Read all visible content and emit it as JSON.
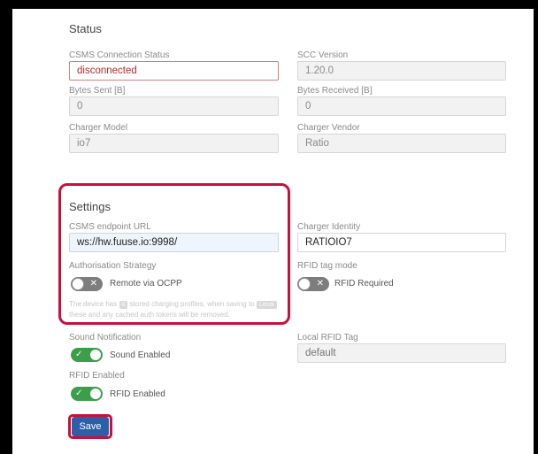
{
  "status": {
    "heading": "Status",
    "csms_connection_status": {
      "label": "CSMS Connection Status",
      "value": "disconnected"
    },
    "scc_version": {
      "label": "SCC Version",
      "value": "1.20.0"
    },
    "bytes_sent": {
      "label": "Bytes Sent [B]",
      "value": "0"
    },
    "bytes_received": {
      "label": "Bytes Received [B]",
      "value": "0"
    },
    "charger_model": {
      "label": "Charger Model",
      "value": "io7"
    },
    "charger_vendor": {
      "label": "Charger Vendor",
      "value": "Ratio"
    }
  },
  "settings": {
    "heading": "Settings",
    "csms_endpoint_url": {
      "label": "CSMS endpoint URL",
      "value": "ws://hw.fuuse.io:9998/"
    },
    "charger_identity": {
      "label": "Charger Identity",
      "value": "RATIOIO7"
    },
    "authorisation_strategy": {
      "label": "Authorisation Strategy",
      "toggle_label": "Remote via OCPP",
      "enabled": false
    },
    "rfid_tag_mode": {
      "label": "RFID tag mode",
      "toggle_label": "RFID Required",
      "enabled": false
    },
    "note": {
      "part1": "The device has",
      "count": "0",
      "part2": "stored charging profiles, when saving to",
      "badge": "Local",
      "part3": "these and any cached auth tokens will be removed."
    },
    "sound_notification": {
      "label": "Sound Notification",
      "toggle_label": "Sound Enabled",
      "enabled": true
    },
    "local_rfid_tag": {
      "label": "Local RFID Tag",
      "placeholder": "default"
    },
    "rfid_enabled": {
      "label": "RFID Enabled",
      "toggle_label": "RFID Enabled",
      "enabled": true
    },
    "save_label": "Save"
  },
  "glyphs": {
    "off": "✕",
    "on": "✓"
  },
  "colors": {
    "highlight": "#c8103e",
    "toggle_on": "#3c9e4a",
    "toggle_off": "#7d7d7d",
    "save_button": "#2c5fa8",
    "error_text": "#b02a2a"
  }
}
